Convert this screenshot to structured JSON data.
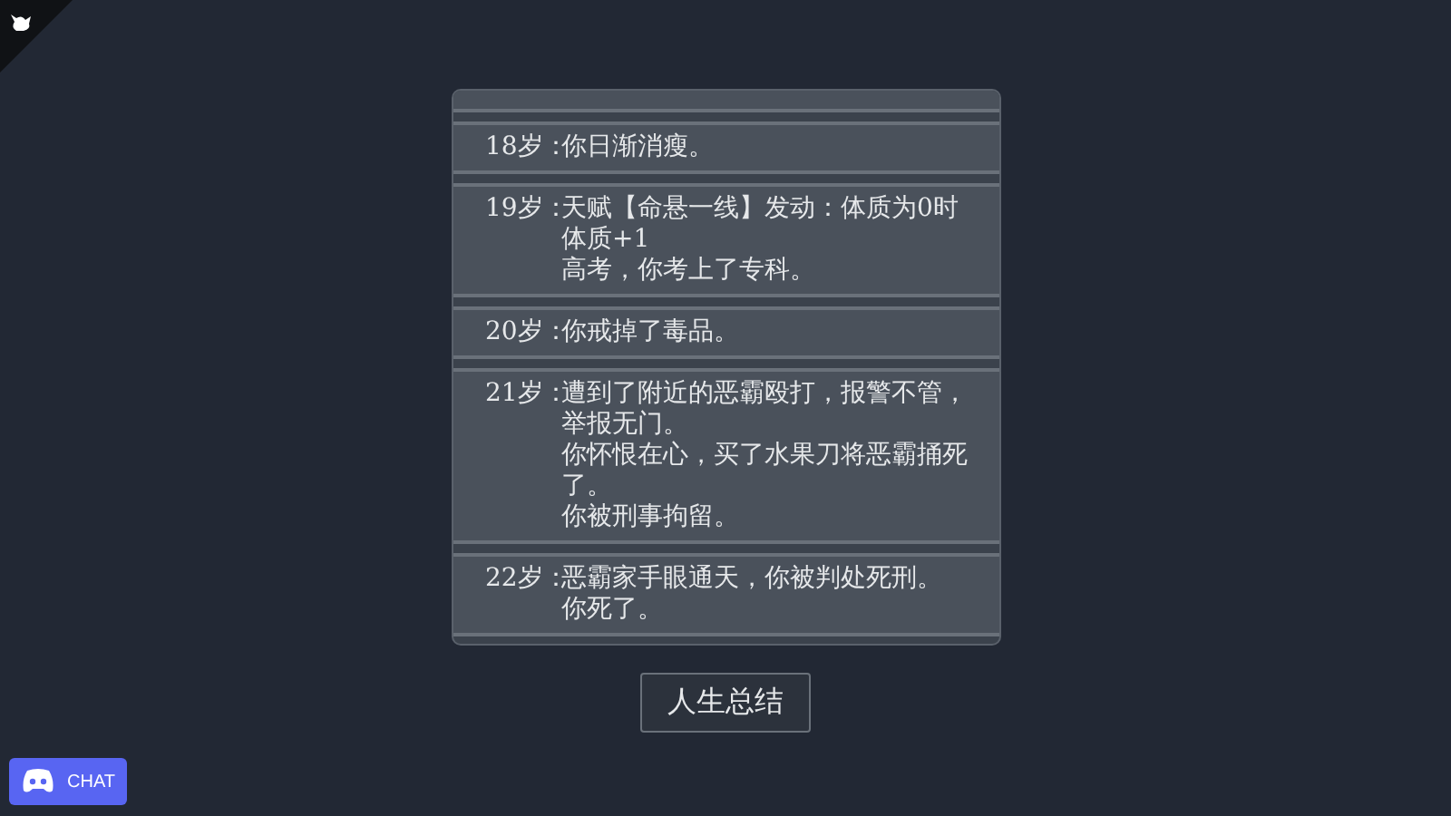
{
  "log": [
    {
      "age": "18岁：",
      "events": [
        "你日渐消瘦。"
      ]
    },
    {
      "age": "19岁：",
      "events": [
        "天赋【命悬一线】发动：体质为0时体质+1",
        "高考，你考上了专科。"
      ]
    },
    {
      "age": "20岁：",
      "events": [
        "你戒掉了毒品。"
      ]
    },
    {
      "age": "21岁：",
      "events": [
        "遭到了附近的恶霸殴打，报警不管，举报无门。",
        "你怀恨在心，买了水果刀将恶霸捅死了。",
        "你被刑事拘留。"
      ]
    },
    {
      "age": "22岁：",
      "events": [
        "恶霸家手眼通天，你被判处死刑。",
        "你死了。"
      ]
    }
  ],
  "summary_button": "人生总结",
  "chat_button": "CHAT"
}
